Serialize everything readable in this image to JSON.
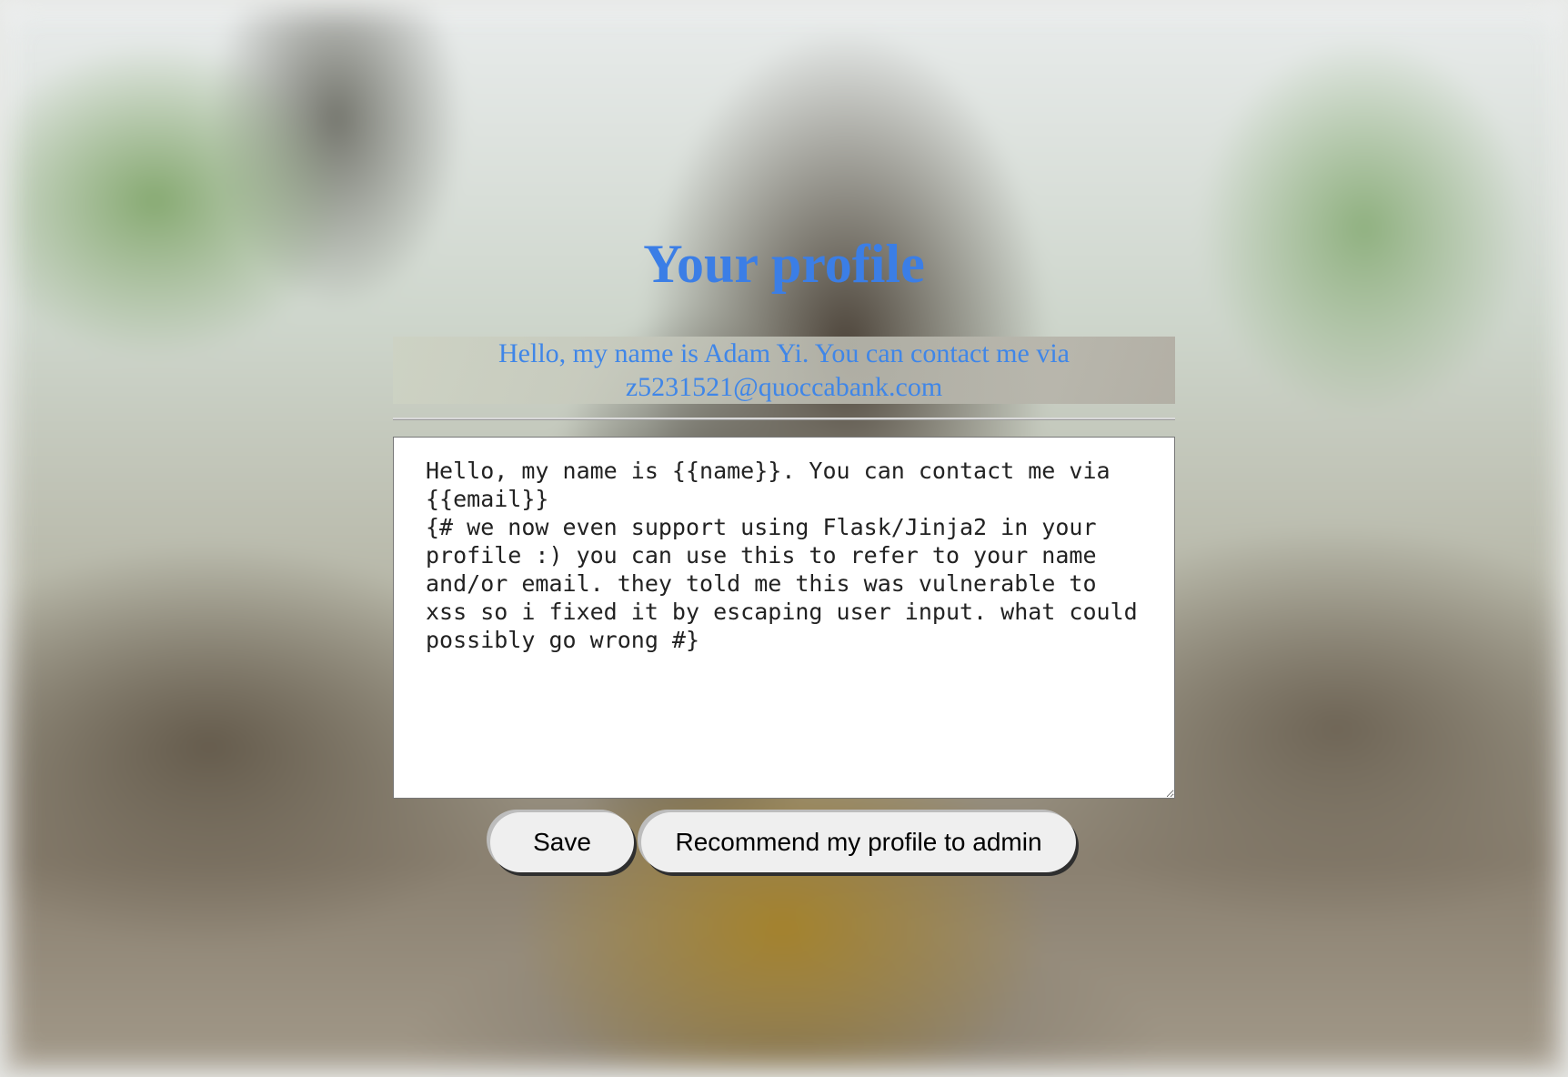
{
  "page": {
    "title": "Your profile",
    "rendered_profile": "Hello, my name is Adam Yi. You can contact me via z5231521@quoccabank.com",
    "profile_template": "Hello, my name is {{name}}. You can contact me via {{email}}\n{# we now even support using Flask/Jinja2 in your profile :) you can use this to refer to your name and/or email. they told me this was vulnerable to xss so i fixed it by escaping user input. what could possibly go wrong #}"
  },
  "buttons": {
    "save_label": "Save",
    "recommend_label": "Recommend my profile to admin"
  },
  "colors": {
    "accent": "#3b7ee6",
    "button_bg": "#efefef"
  }
}
